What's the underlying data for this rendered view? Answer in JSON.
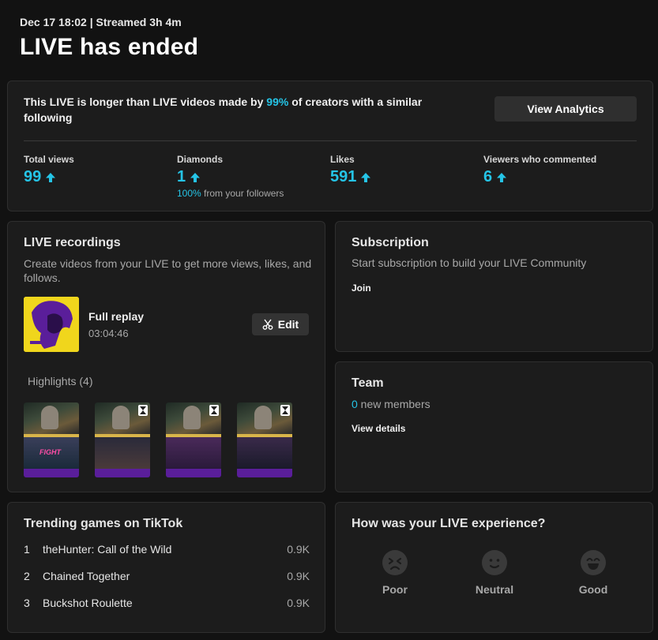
{
  "header": {
    "meta": "Dec 17 18:02 | Streamed 3h 4m",
    "title": "LIVE has ended"
  },
  "summary": {
    "text_before": "This LIVE is longer than LIVE videos made by ",
    "highlight": "99%",
    "text_after": " of creators with a similar following",
    "analytics_button": "View Analytics",
    "stats": [
      {
        "label": "Total views",
        "value": "99"
      },
      {
        "label": "Diamonds",
        "value": "1",
        "sub_highlight": "100%",
        "sub_text": " from your followers"
      },
      {
        "label": "Likes",
        "value": "591"
      },
      {
        "label": "Viewers who commented",
        "value": "6"
      }
    ]
  },
  "recordings": {
    "title": "LIVE recordings",
    "description": "Create videos from your LIVE to get more views, likes, and follows.",
    "replay_title": "Full replay",
    "replay_duration": "03:04:46",
    "edit_label": "Edit",
    "highlights_label": "Highlights (4)",
    "fight_text": "FIGHT"
  },
  "subscription": {
    "title": "Subscription",
    "description": "Start subscription to build your LIVE Community",
    "join": "Join"
  },
  "team": {
    "title": "Team",
    "count": "0",
    "members_text": " new members",
    "details": "View details"
  },
  "trending": {
    "title": "Trending games on TikTok",
    "items": [
      {
        "rank": "1",
        "name": "theHunter: Call of the Wild",
        "value": "0.9K"
      },
      {
        "rank": "2",
        "name": "Chained Together",
        "value": "0.9K"
      },
      {
        "rank": "3",
        "name": "Buckshot Roulette",
        "value": "0.9K"
      }
    ]
  },
  "feedback": {
    "title": "How was your LIVE experience?",
    "options": [
      "Poor",
      "Neutral",
      "Good"
    ]
  },
  "colors": {
    "accent": "#25c4e6",
    "background": "#121212",
    "card": "#1c1c1c",
    "thumb_yellow": "#f0d61c",
    "thumb_purple": "#5a1e9a"
  }
}
